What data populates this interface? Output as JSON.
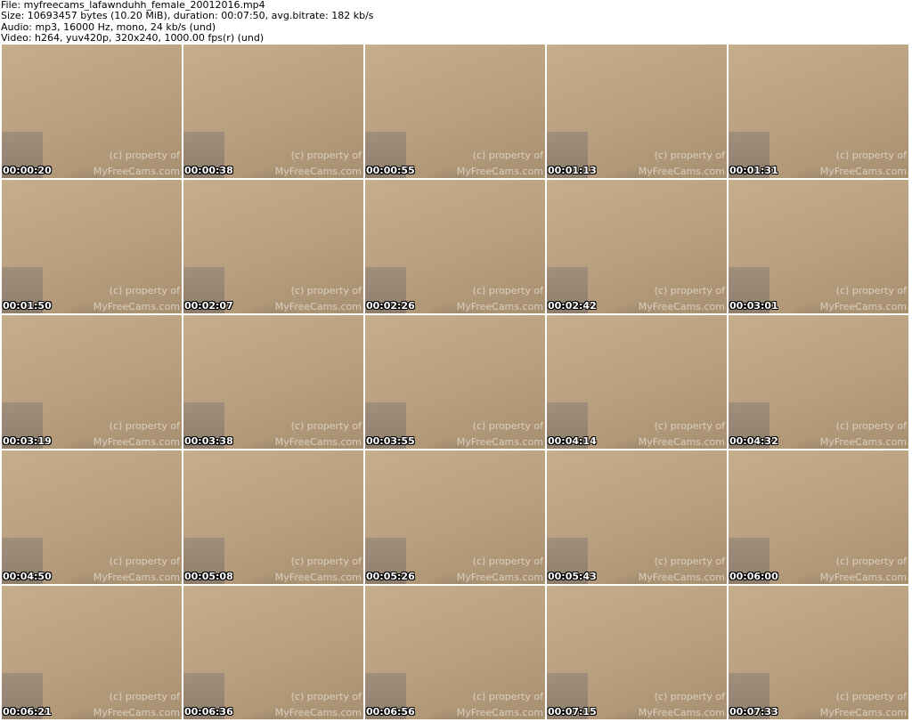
{
  "info": {
    "file": "File: myfreecams_lafawnduhh_female_20012016.mp4",
    "size": "Size: 10693457 bytes (10.20 MiB), duration: 00:07:50, avg.bitrate: 182 kb/s",
    "audio": "Audio: mp3, 16000 Hz, mono, 24 kb/s (und)",
    "video": "Video: h264, yuv420p, 320x240, 1000.00 fps(r) (und)"
  },
  "watermark": {
    "line1": "(c) property of",
    "line2": "MyFreeCams.com"
  },
  "frames": [
    "00:00:20",
    "00:00:38",
    "00:00:55",
    "00:01:13",
    "00:01:31",
    "00:01:50",
    "00:02:07",
    "00:02:26",
    "00:02:42",
    "00:03:01",
    "00:03:19",
    "00:03:38",
    "00:03:55",
    "00:04:14",
    "00:04:32",
    "00:04:50",
    "00:05:08",
    "00:05:26",
    "00:05:43",
    "00:06:00",
    "00:06:21",
    "00:06:36",
    "00:06:56",
    "00:07:15",
    "00:07:33"
  ]
}
